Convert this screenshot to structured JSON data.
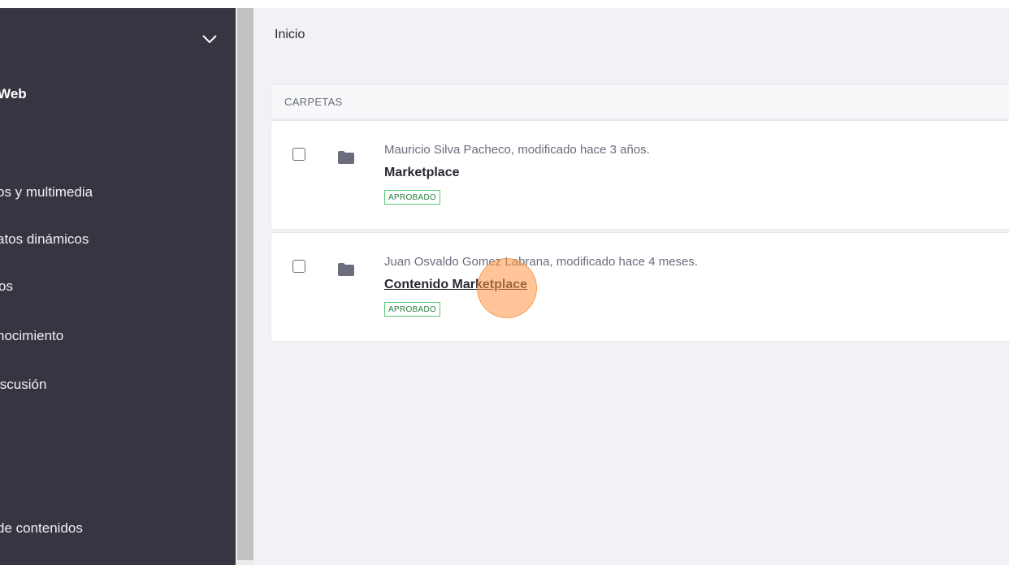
{
  "sidebar": {
    "site_name": "o Web",
    "items": [
      {
        "label": "os y multimedia"
      },
      {
        "label": "atos dinámicos"
      },
      {
        "label": "os"
      },
      {
        "label": "nocimiento"
      },
      {
        "label": "iscusión"
      },
      {
        "label": " de contenidos"
      }
    ]
  },
  "breadcrumb": {
    "label": "Inicio"
  },
  "section": {
    "header": "CARPETAS"
  },
  "folders": [
    {
      "meta": "Mauricio Silva Pacheco, modificado hace 3 años.",
      "title": "Marketplace",
      "status": "APROBADO"
    },
    {
      "meta": "Juan Osvaldo Gomez Labrana, modificado hace 4 meses.",
      "title": "Contenido Marketplace",
      "status": "APROBADO"
    }
  ],
  "colors": {
    "sidebar_bg": "#363642",
    "main_bg": "#f1f2f6",
    "status_green": "#287d3c",
    "click_highlight": "#ff9646"
  }
}
